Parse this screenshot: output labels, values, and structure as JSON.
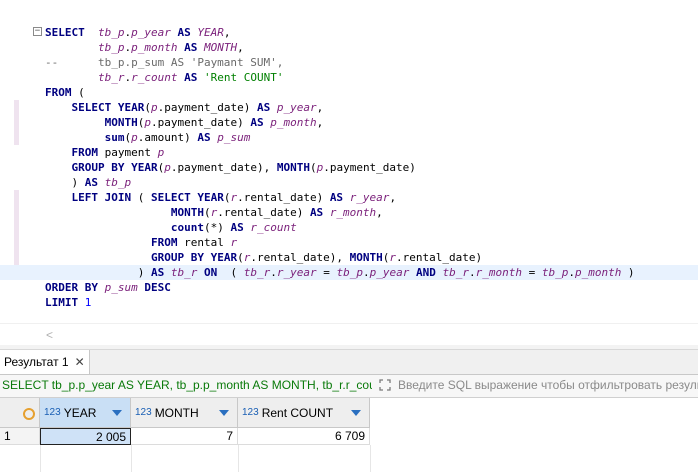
{
  "editor": {
    "lines": [
      {
        "tokens": [
          [
            "kw",
            "SELECT  "
          ],
          [
            "al",
            "tb_p"
          ],
          [
            "",
            "."
          ],
          [
            "al",
            "p_year"
          ],
          [
            "kw",
            " AS "
          ],
          [
            "al",
            "YEAR"
          ],
          [
            "",
            ","
          ]
        ]
      },
      {
        "tokens": [
          [
            "",
            "        "
          ],
          [
            "al",
            "tb_p"
          ],
          [
            "",
            "."
          ],
          [
            "al",
            "p_month"
          ],
          [
            "kw",
            " AS "
          ],
          [
            "al",
            "MONTH"
          ],
          [
            "",
            ","
          ]
        ]
      },
      {
        "tokens": [
          [
            "cm",
            "--      tb_p.p_sum AS 'Paymant SUM',"
          ]
        ]
      },
      {
        "tokens": [
          [
            "",
            "        "
          ],
          [
            "al",
            "tb_r"
          ],
          [
            "",
            "."
          ],
          [
            "al",
            "r_count"
          ],
          [
            "kw",
            " AS "
          ],
          [
            "str",
            "'Rent COUNT'"
          ]
        ]
      },
      {
        "tokens": [
          [
            "kw",
            "FROM"
          ],
          [
            "",
            " ("
          ]
        ]
      },
      {
        "tokens": [
          [
            "",
            "    "
          ],
          [
            "kw",
            "SELECT "
          ],
          [
            "fn",
            "YEAR"
          ],
          [
            "",
            "("
          ],
          [
            "al",
            "p"
          ],
          [
            "",
            ".payment_date) "
          ],
          [
            "kw",
            "AS "
          ],
          [
            "al",
            "p_year"
          ],
          [
            "",
            ","
          ]
        ]
      },
      {
        "tokens": [
          [
            "",
            "         "
          ],
          [
            "fn",
            "MONTH"
          ],
          [
            "",
            "("
          ],
          [
            "al",
            "p"
          ],
          [
            "",
            ".payment_date) "
          ],
          [
            "kw",
            "AS "
          ],
          [
            "al",
            "p_month"
          ],
          [
            "",
            ","
          ]
        ]
      },
      {
        "tokens": [
          [
            "",
            "         "
          ],
          [
            "fn",
            "sum"
          ],
          [
            "",
            "("
          ],
          [
            "al",
            "p"
          ],
          [
            "",
            ".amount) "
          ],
          [
            "kw",
            "AS "
          ],
          [
            "al",
            "p_sum"
          ]
        ]
      },
      {
        "tokens": [
          [
            "",
            "    "
          ],
          [
            "kw",
            "FROM "
          ],
          [
            "",
            "payment "
          ],
          [
            "al",
            "p"
          ]
        ]
      },
      {
        "tokens": [
          [
            "",
            "    "
          ],
          [
            "kw",
            "GROUP BY "
          ],
          [
            "fn",
            "YEAR"
          ],
          [
            "",
            "("
          ],
          [
            "al",
            "p"
          ],
          [
            "",
            ".payment_date), "
          ],
          [
            "fn",
            "MONTH"
          ],
          [
            "",
            "("
          ],
          [
            "al",
            "p"
          ],
          [
            "",
            ".payment_date)"
          ]
        ]
      },
      {
        "tokens": [
          [
            "",
            "    ) "
          ],
          [
            "kw",
            "AS "
          ],
          [
            "al",
            "tb_p"
          ]
        ]
      },
      {
        "tokens": [
          [
            "",
            "    "
          ],
          [
            "kw",
            "LEFT JOIN"
          ],
          [
            "",
            " ( "
          ],
          [
            "kw",
            "SELECT "
          ],
          [
            "fn",
            "YEAR"
          ],
          [
            "",
            "("
          ],
          [
            "al",
            "r"
          ],
          [
            "",
            ".rental_date) "
          ],
          [
            "kw",
            "AS "
          ],
          [
            "al",
            "r_year"
          ],
          [
            "",
            ","
          ]
        ]
      },
      {
        "tokens": [
          [
            "",
            "                   "
          ],
          [
            "fn",
            "MONTH"
          ],
          [
            "",
            "("
          ],
          [
            "al",
            "r"
          ],
          [
            "",
            ".rental_date) "
          ],
          [
            "kw",
            "AS "
          ],
          [
            "al",
            "r_month"
          ],
          [
            "",
            ","
          ]
        ]
      },
      {
        "tokens": [
          [
            "",
            "                   "
          ],
          [
            "fn",
            "count"
          ],
          [
            "",
            "(*) "
          ],
          [
            "kw",
            "AS "
          ],
          [
            "al",
            "r_count"
          ]
        ]
      },
      {
        "tokens": [
          [
            "",
            "                "
          ],
          [
            "kw",
            "FROM "
          ],
          [
            "",
            "rental "
          ],
          [
            "al",
            "r"
          ]
        ]
      },
      {
        "tokens": [
          [
            "",
            "                "
          ],
          [
            "kw",
            "GROUP BY "
          ],
          [
            "fn",
            "YEAR"
          ],
          [
            "",
            "("
          ],
          [
            "al",
            "r"
          ],
          [
            "",
            ".rental_date), "
          ],
          [
            "fn",
            "MONTH"
          ],
          [
            "",
            "("
          ],
          [
            "al",
            "r"
          ],
          [
            "",
            ".rental_date)"
          ]
        ]
      },
      {
        "tokens": [
          [
            "",
            "              ) "
          ],
          [
            "kw",
            "AS "
          ],
          [
            "al",
            "tb_r"
          ],
          [
            "kw",
            " ON "
          ],
          [
            "",
            " ( "
          ],
          [
            "al",
            "tb_r"
          ],
          [
            "",
            "."
          ],
          [
            "al",
            "r_year"
          ],
          [
            "",
            " = "
          ],
          [
            "al",
            "tb_p"
          ],
          [
            "",
            "."
          ],
          [
            "al",
            "p_year"
          ],
          [
            "kw",
            " AND "
          ],
          [
            "al",
            "tb_r"
          ],
          [
            "",
            "."
          ],
          [
            "al",
            "r_month"
          ],
          [
            "",
            " = "
          ],
          [
            "al",
            "tb_p"
          ],
          [
            "",
            "."
          ],
          [
            "al",
            "p_month"
          ],
          [
            "",
            " )"
          ]
        ],
        "highlight": true
      },
      {
        "tokens": [
          [
            "kw",
            "ORDER BY "
          ],
          [
            "al",
            "p_sum"
          ],
          [
            "kw",
            " DESC"
          ]
        ]
      },
      {
        "tokens": [
          [
            "kw",
            "LIMIT "
          ],
          [
            "num",
            "1"
          ]
        ]
      }
    ]
  },
  "results": {
    "tab_label": "Результат 1",
    "close_glyph": "✕",
    "query_text": "SELECT tb_p.p_year AS YEAR, tb_p.p_month AS MONTH, tb_r.r_count AS",
    "filter_placeholder": "Введите SQL выражение чтобы отфильтровать результ",
    "columns": [
      {
        "type": "123",
        "name": "YEAR"
      },
      {
        "type": "123",
        "name": "MONTH"
      },
      {
        "type": "123",
        "name": "Rent COUNT"
      }
    ],
    "rows": [
      {
        "num": "1",
        "values": [
          "2 005",
          "7",
          "6 709"
        ]
      }
    ]
  }
}
